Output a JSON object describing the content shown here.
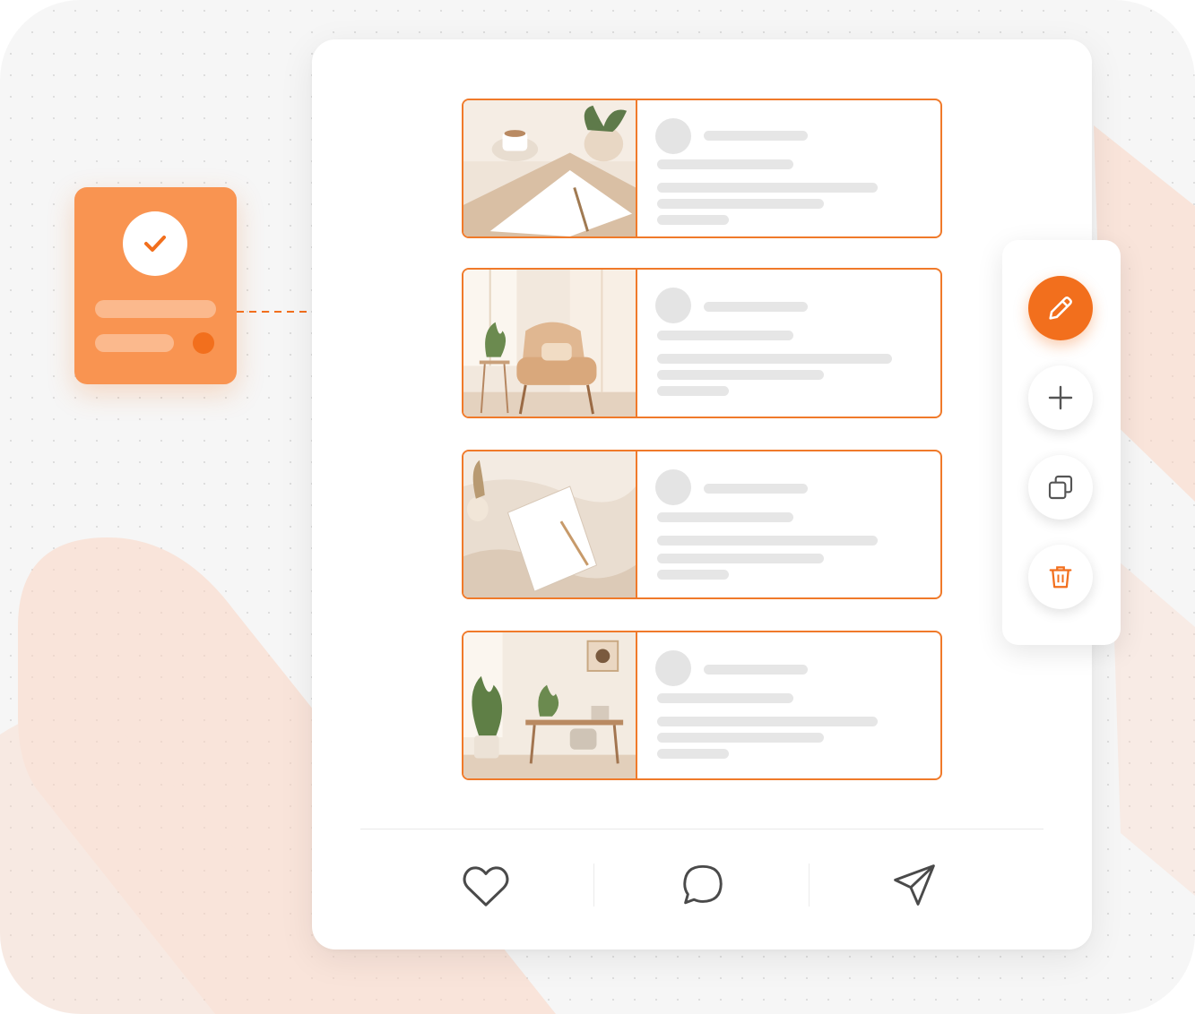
{
  "colors": {
    "accent": "#f26f1d",
    "accent_soft": "#f99451",
    "post_border": "#f07a2a",
    "placeholder": "#e6e6e6",
    "icon_gray": "#555555"
  },
  "approved_card": {
    "status_icon": "check-icon",
    "status_dot_color": "#f26f1d"
  },
  "posts": [
    {
      "image": "cafe-desk-photo"
    },
    {
      "image": "armchair-room-photo"
    },
    {
      "image": "notebook-fabric-photo"
    },
    {
      "image": "plant-office-photo"
    }
  ],
  "toolbar": {
    "buttons": [
      {
        "icon": "pencil-icon",
        "active": true
      },
      {
        "icon": "plus-icon",
        "active": false
      },
      {
        "icon": "duplicate-icon",
        "active": false
      },
      {
        "icon": "trash-icon",
        "active": false
      }
    ]
  },
  "footer_actions": [
    {
      "icon": "heart-icon"
    },
    {
      "icon": "comment-icon"
    },
    {
      "icon": "send-icon"
    }
  ]
}
